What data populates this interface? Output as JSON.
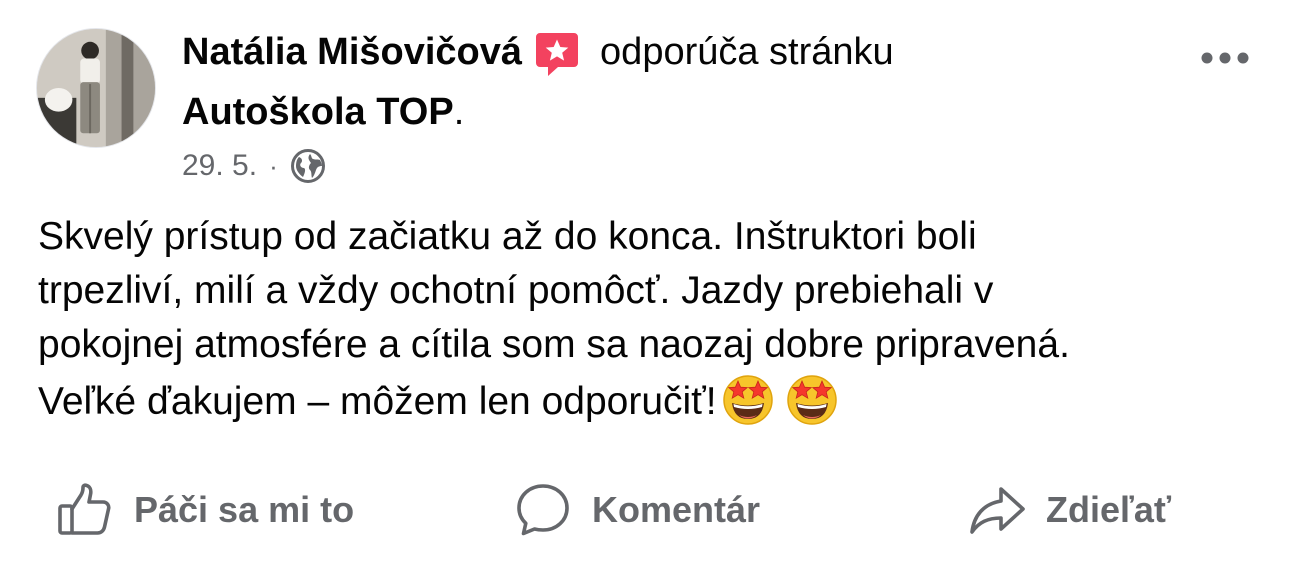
{
  "post": {
    "author": "Natália Mišovičová",
    "recommends_text": "odporúča stránku",
    "page_name": "Autoškola TOP",
    "period": ".",
    "date": "29. 5.",
    "separator": "·",
    "privacy_icon": "globe-icon",
    "badge_icon": "recommend-star-icon",
    "more_icon": "more-horizontal-icon",
    "text_lines": [
      "Skvelý prístup od začiatku až do konca. Inštruktori boli",
      "trpezliví, milí a vždy ochotní pomôcť. Jazdy prebiehali v",
      "pokojnej atmosfére a cítila som sa naozaj dobre pripravená.",
      "Veľké ďakujem – môžem len odporučiť!"
    ],
    "emojis": [
      "star-struck-emoji",
      "star-struck-emoji"
    ]
  },
  "actions": {
    "like": {
      "label": "Páči sa mi to",
      "icon": "thumbs-up-icon"
    },
    "comment": {
      "label": "Komentár",
      "icon": "comment-bubble-icon"
    },
    "share": {
      "label": "Zdieľať",
      "icon": "share-arrow-icon"
    }
  },
  "colors": {
    "text_primary": "#050505",
    "text_secondary": "#65676b",
    "badge_pink": "#f3425f",
    "background": "#ffffff"
  }
}
